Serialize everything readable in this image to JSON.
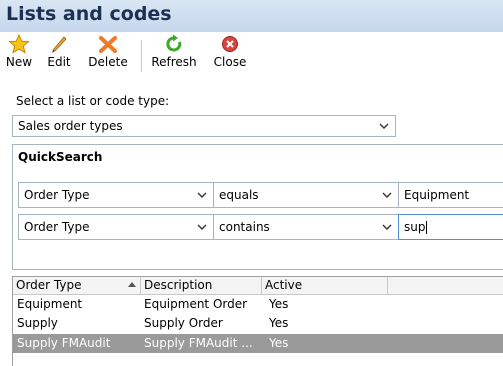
{
  "window": {
    "title": "Lists and codes"
  },
  "toolbar": {
    "new_label": "New",
    "edit_label": "Edit",
    "delete_label": "Delete",
    "refresh_label": "Refresh",
    "close_label": "Close"
  },
  "list_select": {
    "label": "Select a list or code type:",
    "value": "Sales order types"
  },
  "quicksearch": {
    "title": "QuickSearch",
    "rows": [
      {
        "field": "Order Type",
        "operator": "equals",
        "value": "Equipment"
      },
      {
        "field": "Order Type",
        "operator": "contains",
        "value": "sup"
      }
    ]
  },
  "grid": {
    "columns": [
      "Order Type",
      "Description",
      "Active"
    ],
    "sort_column": "Order Type",
    "rows": [
      {
        "order_type": "Equipment",
        "description": "Equipment Order",
        "active": "Yes"
      },
      {
        "order_type": "Supply",
        "description": "Supply Order",
        "active": "Yes"
      },
      {
        "order_type": "Supply FMAudit",
        "description": "Supply FMAudit ...",
        "active": "Yes",
        "selected": true
      }
    ]
  },
  "colors": {
    "titlebar": "#c5d7ec",
    "title_text": "#1a3152",
    "selected_row": "#9a9a9a",
    "focus_border": "#4f8fd6"
  },
  "icons": {
    "new": "star-icon",
    "edit": "pencil-icon",
    "delete": "x-icon",
    "refresh": "refresh-icon",
    "close": "close-icon"
  }
}
